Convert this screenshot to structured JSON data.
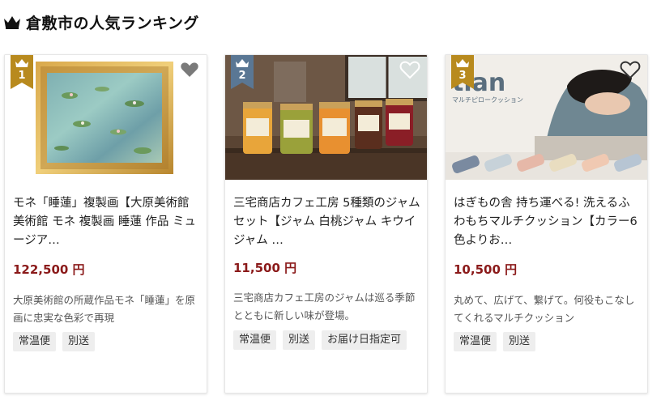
{
  "header": {
    "title": "倉敷市の人気ランキング",
    "icon": "crown-icon"
  },
  "colors": {
    "gold": "#b88a1e",
    "slate": "#5a7794",
    "price": "#8b1a1a"
  },
  "cards": [
    {
      "rank": "1",
      "badge_color": "#b88a1e",
      "title": "モネ「睡蓮」複製画【大原美術館 美術館 モネ 複製画 睡蓮 作品 ミュージア…",
      "price": "122,500 円",
      "desc": "大原美術館の所蔵作品モネ「睡蓮」を原画に忠実な色彩で再現",
      "tags": [
        "常温便",
        "別送"
      ]
    },
    {
      "rank": "2",
      "badge_color": "#5a7794",
      "title": "三宅商店カフェ工房 5種類のジャムセット【ジャム 白桃ジャム キウイジャム …",
      "price": "11,500 円",
      "desc": "三宅商店カフェ工房のジャムは巡る季節とともに新しい味が登場。",
      "tags": [
        "常温便",
        "別送",
        "お届け日指定可"
      ]
    },
    {
      "rank": "3",
      "badge_color": "#b88a1e",
      "title": "はぎもの舎 持ち運べる! 洗えるふわもちマルチクッション【カラー6色よりお…",
      "price": "10,500 円",
      "desc": "丸めて、広げて、繋げて。何役もこなしてくれるマルチクッション",
      "tags": [
        "常温便",
        "別送"
      ],
      "image_text": "tian",
      "image_subtext": "マルチピロークッション"
    }
  ]
}
